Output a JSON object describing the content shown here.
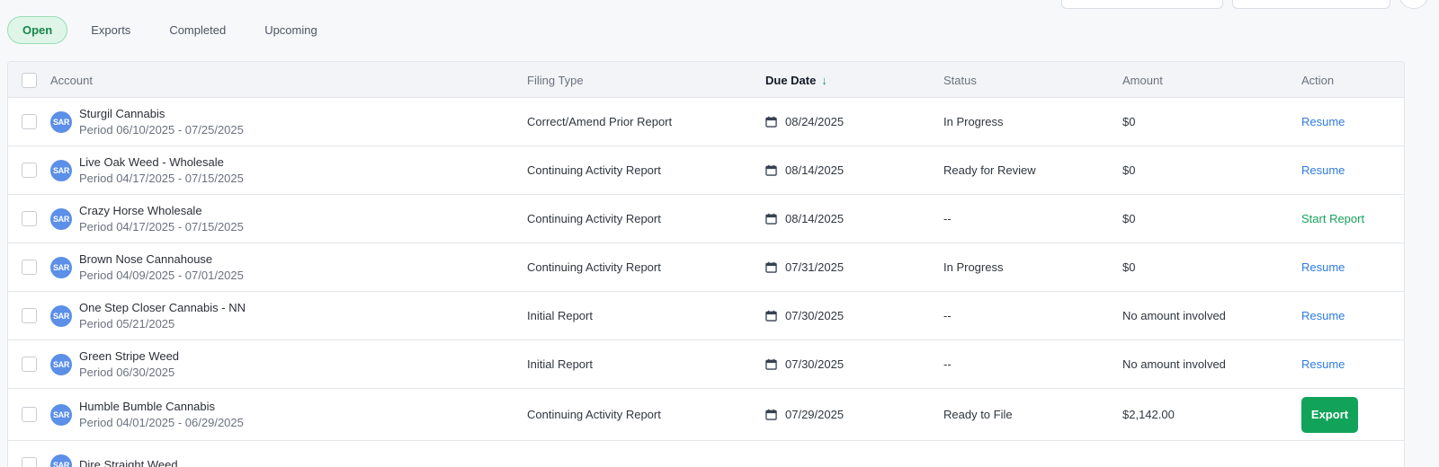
{
  "tabs": [
    {
      "label": "Open",
      "active": true
    },
    {
      "label": "Exports",
      "active": false
    },
    {
      "label": "Completed",
      "active": false
    },
    {
      "label": "Upcoming",
      "active": false
    }
  ],
  "table": {
    "headers": {
      "account": "Account",
      "filing_type": "Filing Type",
      "due_date": "Due Date",
      "status": "Status",
      "amount": "Amount",
      "action": "Action"
    },
    "sort": {
      "column": "Due Date",
      "direction": "descending",
      "icon": "arrow-down-icon",
      "color": "#17a05d"
    },
    "rows": [
      {
        "avatar": "SAR",
        "name": "Sturgil Cannabis",
        "period": "Period 06/10/2025 - 07/25/2025",
        "filing_type": "Correct/Amend Prior Report",
        "due_date": "08/24/2025",
        "status": "In Progress",
        "amount": "$0",
        "action": "Resume"
      },
      {
        "avatar": "SAR",
        "name": "Live Oak Weed - Wholesale",
        "period": "Period 04/17/2025 - 07/15/2025",
        "filing_type": "Continuing Activity Report",
        "due_date": "08/14/2025",
        "status": "Ready for Review",
        "amount": "$0",
        "action": "Resume"
      },
      {
        "avatar": "SAR",
        "name": "Crazy Horse Wholesale",
        "period": "Period 04/17/2025 - 07/15/2025",
        "filing_type": "Continuing Activity Report",
        "due_date": "08/14/2025",
        "status": "--",
        "amount": "$0",
        "action": "Start Report"
      },
      {
        "avatar": "SAR",
        "name": "Brown Nose Cannahouse",
        "period": "Period 04/09/2025 - 07/01/2025",
        "filing_type": "Continuing Activity Report",
        "due_date": "07/31/2025",
        "status": "In Progress",
        "amount": "$0",
        "action": "Resume"
      },
      {
        "avatar": "SAR",
        "name": "One Step Closer Cannabis - NN",
        "period": "Period 05/21/2025",
        "filing_type": "Initial Report",
        "due_date": "07/30/2025",
        "status": "--",
        "amount": "No amount involved",
        "action": "Resume"
      },
      {
        "avatar": "SAR",
        "name": "Green Stripe Weed",
        "period": "Period 06/30/2025",
        "filing_type": "Initial Report",
        "due_date": "07/30/2025",
        "status": "--",
        "amount": "No amount involved",
        "action": "Resume"
      },
      {
        "avatar": "SAR",
        "name": "Humble Bumble Cannabis",
        "period": "Period 04/01/2025 - 06/29/2025",
        "filing_type": "Continuing Activity Report",
        "due_date": "07/29/2025",
        "status": "Ready to File",
        "amount": "$2,142.00",
        "action": "Export"
      },
      {
        "avatar": "SAR",
        "name": "Dire Straight Weed",
        "period": "",
        "filing_type": "",
        "due_date": "",
        "status": "",
        "amount": "",
        "action": ""
      }
    ]
  },
  "colors": {
    "accent_green": "#12a35a",
    "link_blue": "#2f7be0",
    "avatar_blue": "#5b8fe8",
    "active_tab_bg": "#dff5e8"
  }
}
